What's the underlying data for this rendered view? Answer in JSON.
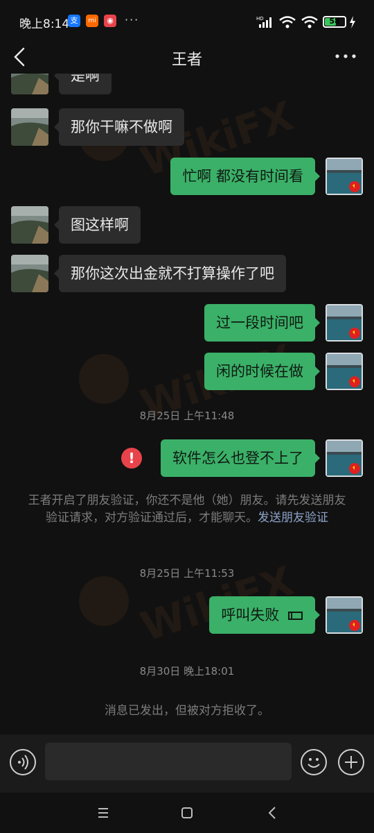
{
  "status_bar": {
    "time": "晚上8:14",
    "battery": "58",
    "battery_level": 0.58,
    "app_icons": [
      {
        "name": "alipay-icon",
        "glyph": "支",
        "color": "#1677ff"
      },
      {
        "name": "mi-icon",
        "glyph": "mi",
        "color": "#ff6900"
      },
      {
        "name": "app-icon",
        "glyph": "◉",
        "color": "#e8434a"
      }
    ],
    "more": "···"
  },
  "header": {
    "title": "王者"
  },
  "messages": [
    {
      "side": "in",
      "text": "是啊"
    },
    {
      "side": "in",
      "text": "那你干嘛不做啊"
    },
    {
      "side": "out",
      "text": "忙啊  都没有时间看"
    },
    {
      "side": "in",
      "text": "图这样啊"
    },
    {
      "side": "in",
      "text": "那你这次出金就不打算操作了吧"
    },
    {
      "side": "out",
      "text": "过一段时间吧"
    },
    {
      "side": "out",
      "text": "闲的时候在做"
    },
    {
      "side": "time",
      "text": "8月25日 上午11:48"
    },
    {
      "side": "out",
      "text": "软件怎么也登不上了",
      "failed": true
    },
    {
      "side": "system",
      "text": "王者开启了朋友验证，你还不是他（她）朋友。请先发送朋友验证请求，对方验证通过后，才能聊天。",
      "link": "发送朋友验证"
    },
    {
      "side": "time",
      "text": "8月25日 上午11:53"
    },
    {
      "side": "out",
      "text": "呼叫失败",
      "call": true
    },
    {
      "side": "time",
      "text": "8月30日 晚上18:01"
    },
    {
      "side": "system",
      "text": "消息已发出，但被对方拒收了。"
    }
  ],
  "watermark": {
    "text": "WikiFX"
  },
  "input_bar": {
    "placeholder": ""
  },
  "colors": {
    "background": "#111111",
    "bubble_in": "#2c2c2c",
    "bubble_out": "#3bb068",
    "error": "#e8434a",
    "link": "#8ea3c9"
  }
}
